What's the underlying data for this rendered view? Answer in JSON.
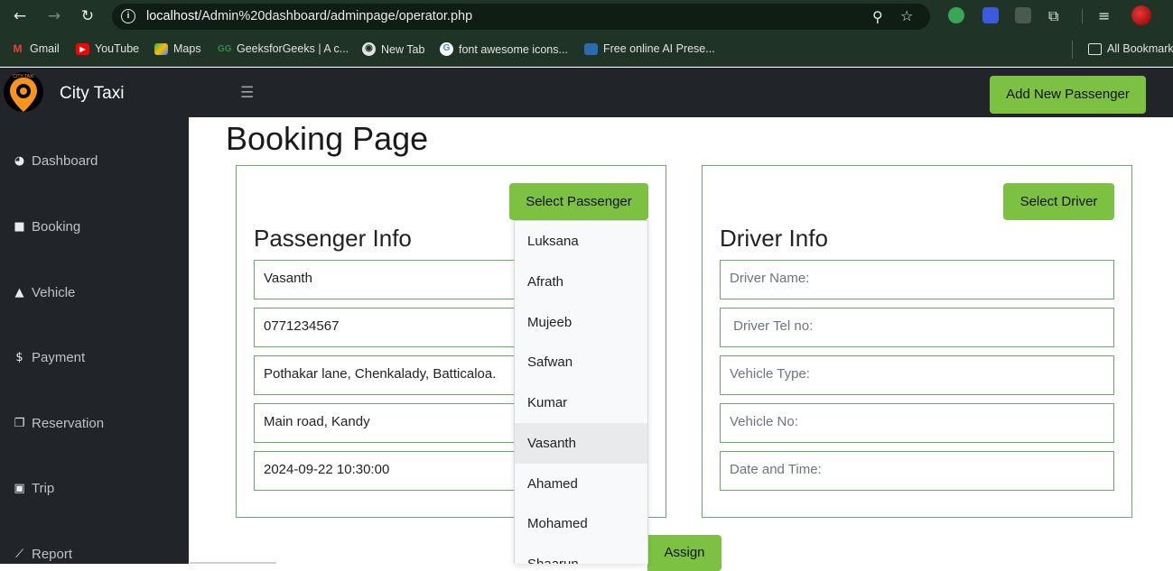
{
  "browser": {
    "url_host": "localhost",
    "url_path": "/Admin%20dashboard/adminpage/operator.php",
    "bookmarks": [
      {
        "label": "Gmail",
        "icon": "gmail-icon"
      },
      {
        "label": "YouTube",
        "icon": "youtube-icon"
      },
      {
        "label": "Maps",
        "icon": "maps-icon"
      },
      {
        "label": "GeeksforGeeks | A c...",
        "icon": "geeksforgeeks-icon"
      },
      {
        "label": "New Tab",
        "icon": "globe-icon"
      },
      {
        "label": "font awesome icons...",
        "icon": "google-icon"
      },
      {
        "label": "Free online AI Prese...",
        "icon": "presentation-icon"
      }
    ],
    "all_bookmarks": "All Bookmarks"
  },
  "app": {
    "brand": "City Taxi",
    "add_passenger_label": "Add New Passenger",
    "logo_text": "CITY TAXI"
  },
  "sidebar": {
    "items": [
      {
        "label": "Dashboard",
        "icon": "dashboard-icon"
      },
      {
        "label": "Booking",
        "icon": "shopping-bag-icon"
      },
      {
        "label": "Vehicle",
        "icon": "car-icon"
      },
      {
        "label": "Payment",
        "icon": "dollar-icon"
      },
      {
        "label": "Reservation",
        "icon": "copy-icon"
      },
      {
        "label": "Trip",
        "icon": "suitcase-icon"
      },
      {
        "label": "Report",
        "icon": "chart-line-icon"
      }
    ]
  },
  "page": {
    "title": "Booking Page",
    "assign_label": "Assign"
  },
  "passenger": {
    "select_label": "Select Passenger",
    "title": "Passenger Info",
    "fields": [
      "Vasanth",
      "0771234567",
      "Pothakar lane, Chenkalady, Batticaloa.",
      "Main road, Kandy",
      "2024-09-22 10:30:00"
    ],
    "dropdown_options": [
      "Luksana",
      "Afrath",
      "Mujeeb",
      "Safwan",
      "Kumar",
      "Vasanth",
      "Ahamed",
      "Mohamed",
      "Shaarun"
    ],
    "dropdown_selected": "Vasanth"
  },
  "driver": {
    "select_label": "Select Driver",
    "title": "Driver Info",
    "placeholders": [
      "Driver Name:",
      " Driver Tel no:",
      "Vehicle Type:",
      "Vehicle No:",
      "Date and Time:"
    ]
  },
  "colors": {
    "accent_green": "#7dc142",
    "border_green": "#5fb15f",
    "sidebar_bg": "#212529",
    "chrome_bg": "#1f3326"
  }
}
